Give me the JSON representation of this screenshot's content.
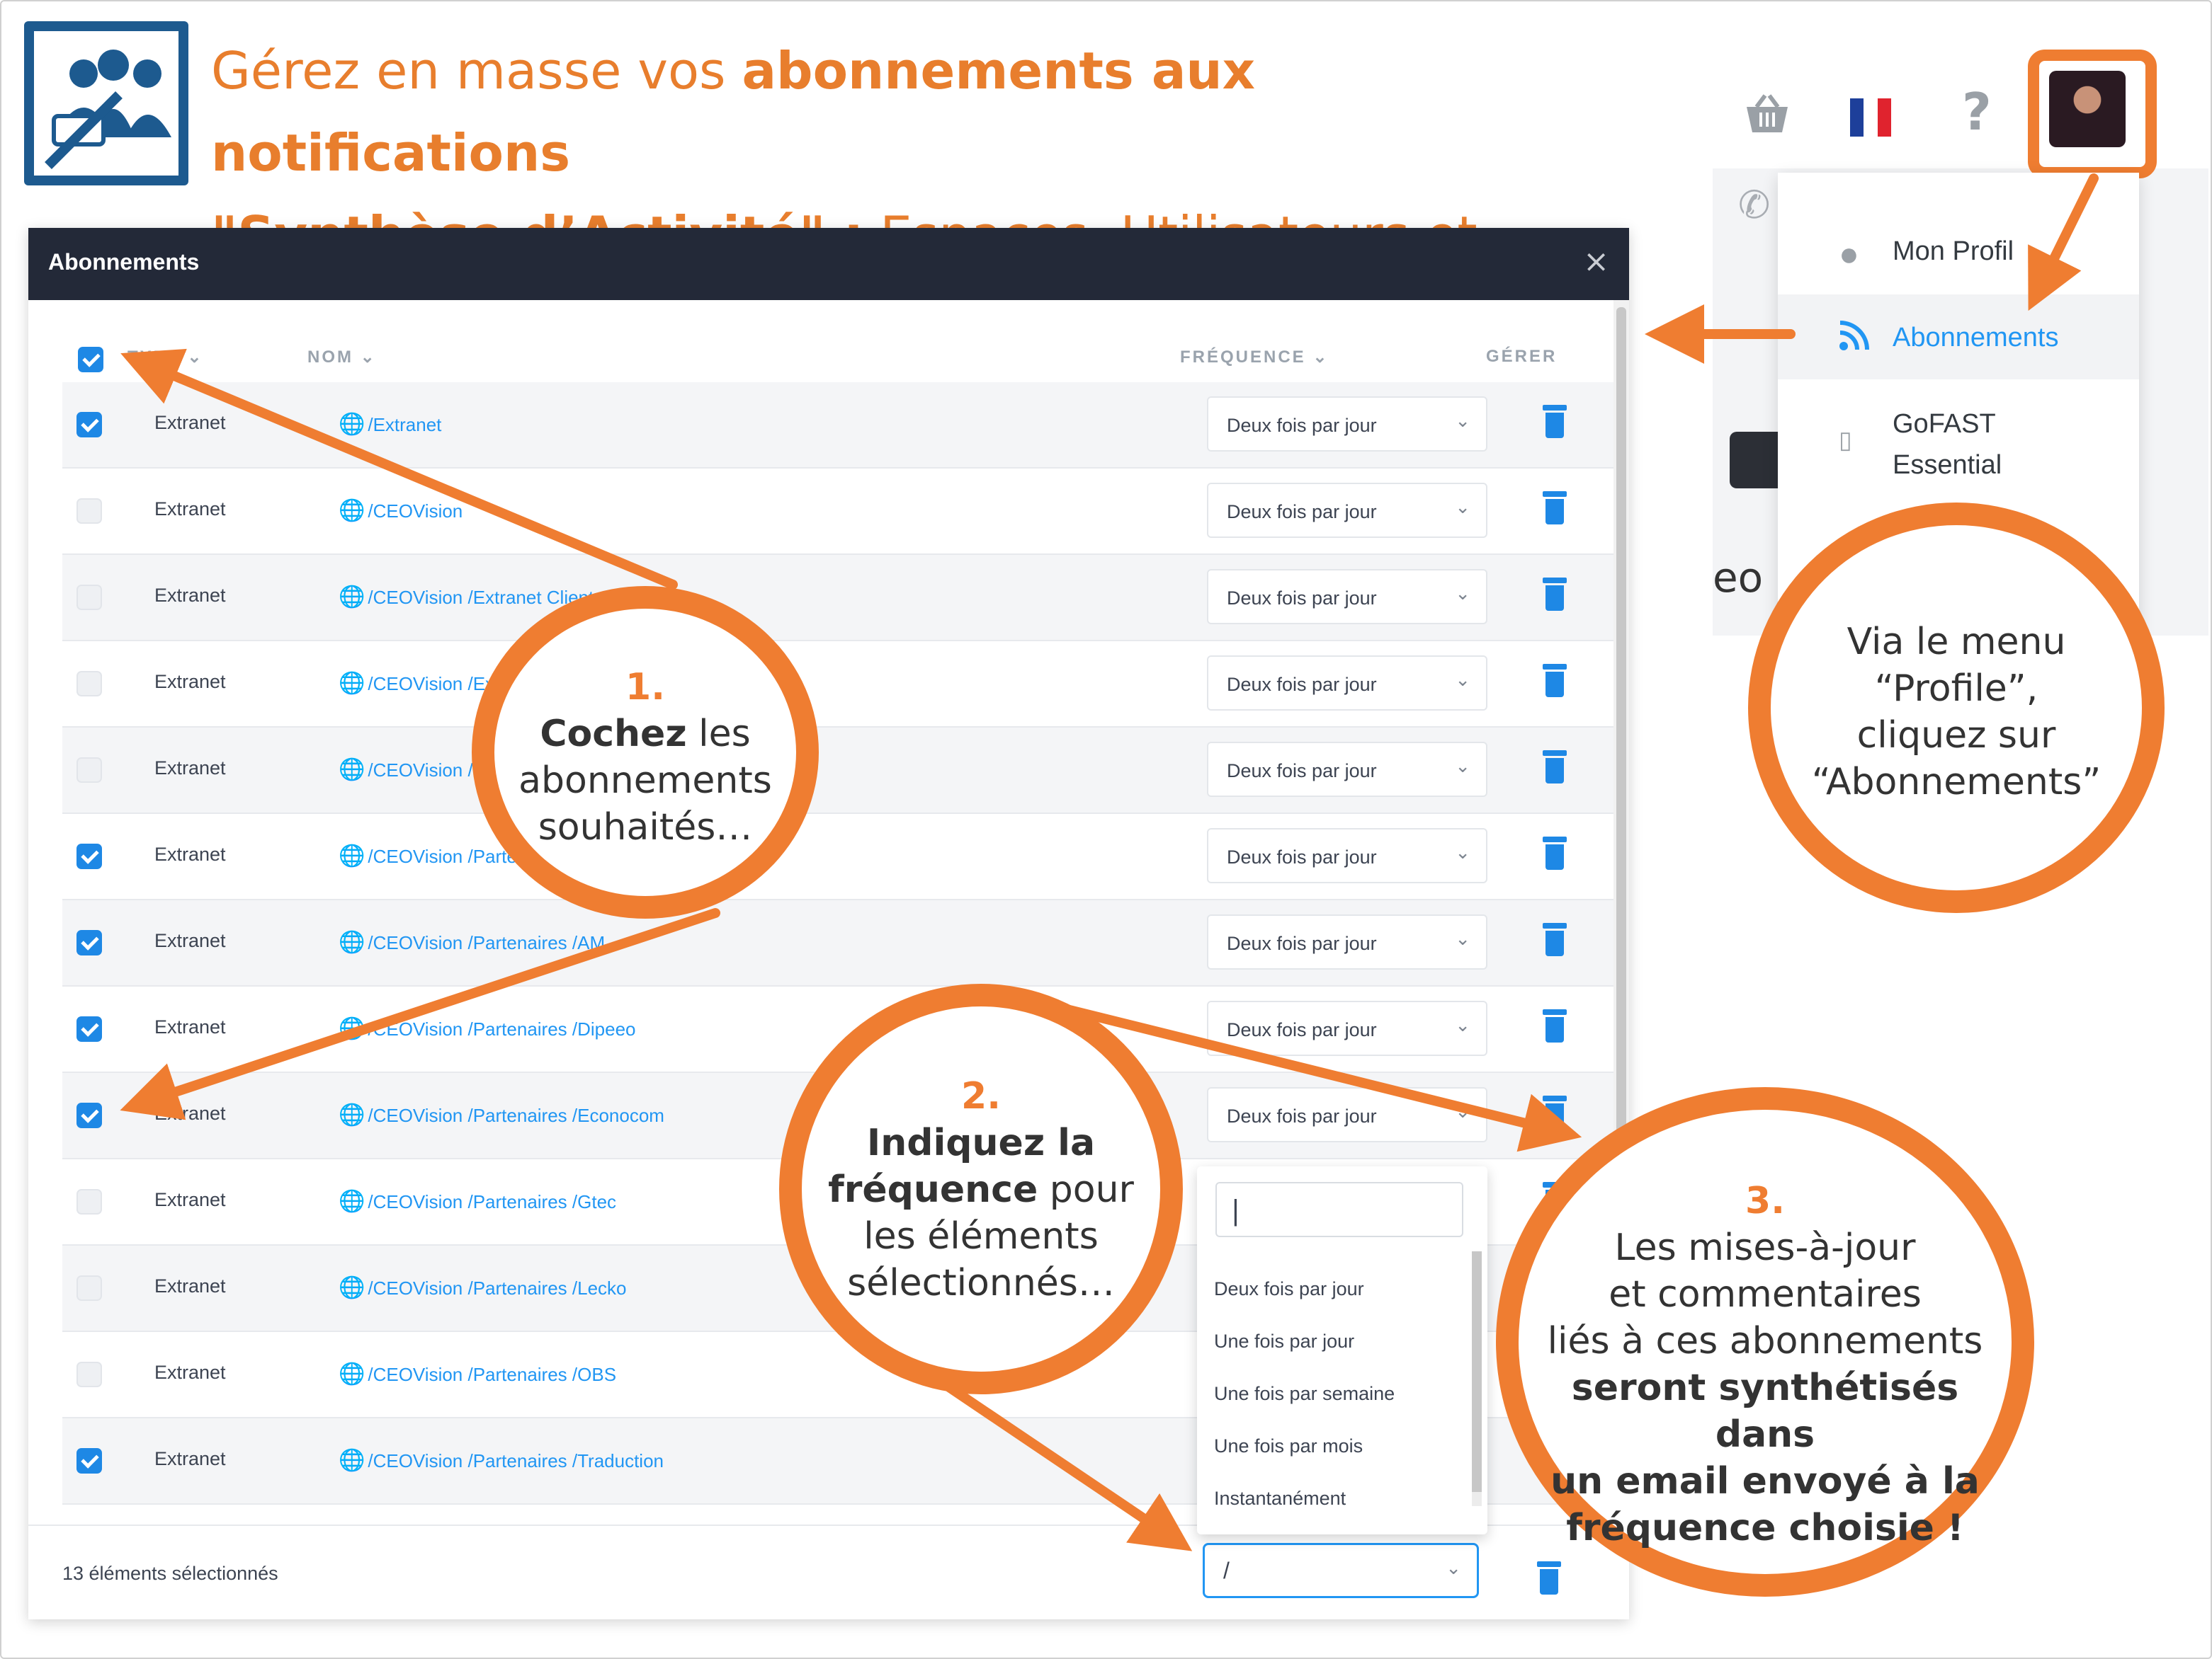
{
  "headline": {
    "line1_plain": "Gérez en masse vos ",
    "line1_bold": "abonnements aux notifications",
    "line2_bold": "\"Synthèse d’Activité\" :",
    "line2_plain": " Espaces, Utilisateurs et Étiquettes."
  },
  "header": {
    "icons": [
      "basket-icon",
      "french-flag-icon",
      "help-icon",
      "avatar"
    ]
  },
  "profile_menu": {
    "items": [
      {
        "label": "Mon Profil",
        "icon": "user-icon"
      },
      {
        "label": "Abonnements",
        "icon": "rss-icon",
        "active": true
      },
      {
        "label": "GoFAST\nEssential",
        "icon": "mobile-icon"
      }
    ]
  },
  "modal": {
    "title": "Abonnements",
    "close": "×",
    "columns": {
      "type": "TYPE",
      "name": "NOM",
      "frequency": "FRÉQUENCE",
      "manage": "GÉRER"
    },
    "rows": [
      {
        "checked": true,
        "type": "Extranet",
        "name": "/Extranet",
        "frequency": "Deux fois par jour"
      },
      {
        "checked": false,
        "type": "Extranet",
        "name": "/CEOVision",
        "frequency": "Deux fois par jour"
      },
      {
        "checked": false,
        "type": "Extranet",
        "name": "/CEOVision /Extranet Clients",
        "frequency": "Deux fois par jour"
      },
      {
        "checked": false,
        "type": "Extranet",
        "name": "/CEOVision /Extra",
        "frequency": "Deux fois par jour"
      },
      {
        "checked": false,
        "type": "Extranet",
        "name": "/CEOVision /Ex",
        "frequency": "Deux fois par jour"
      },
      {
        "checked": true,
        "type": "Extranet",
        "name": "/CEOVision /Parte",
        "frequency": "Deux fois par jour"
      },
      {
        "checked": true,
        "type": "Extranet",
        "name": "/CEOVision /Partenaires /AM",
        "frequency": "Deux fois par jour"
      },
      {
        "checked": true,
        "type": "Extranet",
        "name": "/CEOVision /Partenaires /Dipeeo",
        "frequency": "Deux fois par jour"
      },
      {
        "checked": true,
        "type": "Extranet",
        "name": "/CEOVision /Partenaires /Econocom",
        "frequency": "Deux fois par jour"
      },
      {
        "checked": false,
        "type": "Extranet",
        "name": "/CEOVision /Partenaires /Gtec",
        "frequency": ""
      },
      {
        "checked": false,
        "type": "Extranet",
        "name": "/CEOVision /Partenaires /Lecko",
        "frequency": ""
      },
      {
        "checked": false,
        "type": "Extranet",
        "name": "/CEOVision /Partenaires /OBS",
        "frequency": ""
      },
      {
        "checked": true,
        "type": "Extranet",
        "name": "/CEOVision /Partenaires /Traduction",
        "frequency": ""
      }
    ],
    "footer": {
      "count": "13 éléments sélectionnés",
      "select_value": "/"
    }
  },
  "dropdown": {
    "search_value": "|",
    "options": [
      "Deux fois par jour",
      "Une fois par jour",
      "Une fois par semaine",
      "Une fois par mois",
      "Instantanément"
    ]
  },
  "callouts": {
    "c1": {
      "num": "1.",
      "bold": "Cochez",
      "rest1": " les",
      "line2": "abonnements",
      "line3": "souhaités…"
    },
    "c2": {
      "num": "2.",
      "bold1": "Indiquez la",
      "bold2": "fréquence",
      "rest2": " pour",
      "line3": "les éléments",
      "line4": "sélectionnés…"
    },
    "c3": {
      "num": "3.",
      "line1": "Les mises-à-jour",
      "line2": "et commentaires",
      "line3": "liés à ces abonnements",
      "bold1": "seront synthétisés dans",
      "bold2": "un email envoyé à la",
      "bold3": "fréquence choisie !"
    },
    "c4": {
      "line1": "Via le menu",
      "line2": "“Profile”,",
      "line3": "cliquez sur",
      "line4": "“Abonnements”"
    }
  },
  "colors": {
    "accent": "#ef7d31",
    "primary": "#2196f3",
    "modal_header": "#232938",
    "logo": "#1d5a8f"
  }
}
